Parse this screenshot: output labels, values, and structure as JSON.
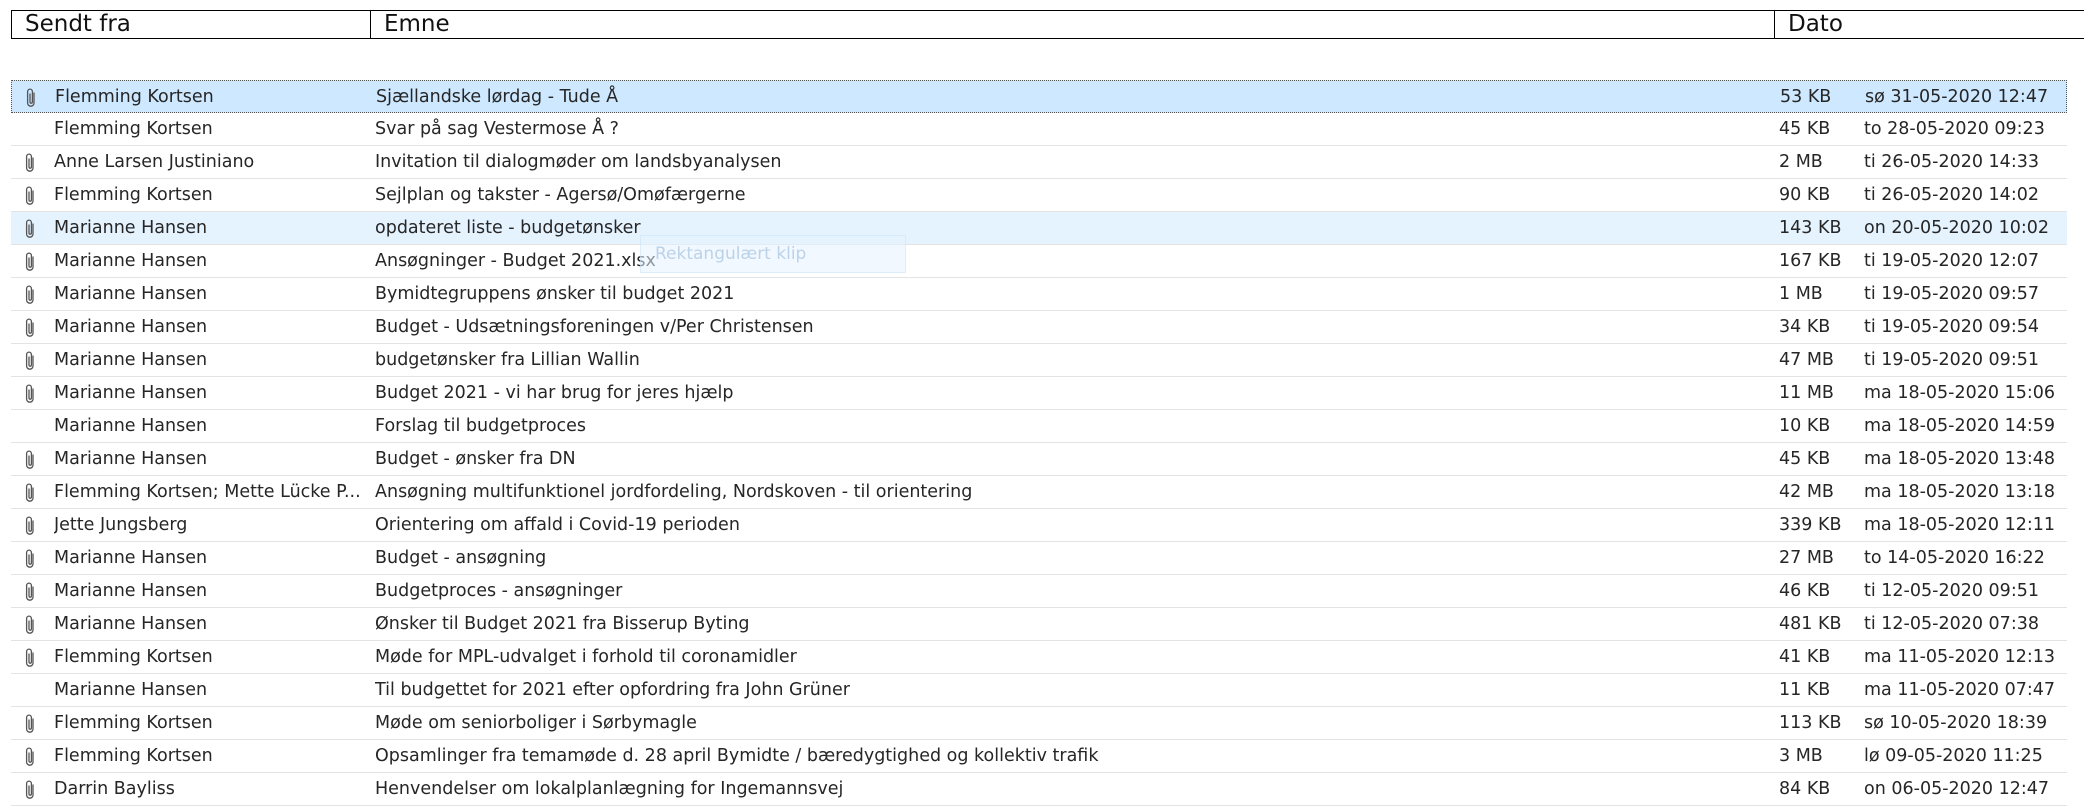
{
  "columns": {
    "from": "Sendt fra",
    "subject": "Emne",
    "date": "Dato"
  },
  "ghost_label": "Rektangulært klip",
  "emails": [
    {
      "from": "Flemming Kortsen",
      "subject": "Sjællandske lørdag - Tude Å",
      "size": "53 KB",
      "date": "sø 31-05-2020 12:47",
      "attachment": true,
      "state": "selected-focus"
    },
    {
      "from": "Flemming Kortsen",
      "subject": "Svar på sag Vestermose Å ?",
      "size": "45 KB",
      "date": "to 28-05-2020 09:23",
      "attachment": false,
      "state": ""
    },
    {
      "from": "Anne Larsen Justiniano",
      "subject": "Invitation til dialogmøder om landsbyanalysen",
      "size": "2 MB",
      "date": "ti 26-05-2020 14:33",
      "attachment": true,
      "state": ""
    },
    {
      "from": "Flemming Kortsen",
      "subject": "Sejlplan og takster - Agersø/Omøfærgerne",
      "size": "90 KB",
      "date": "ti 26-05-2020 14:02",
      "attachment": true,
      "state": ""
    },
    {
      "from": "Marianne Hansen",
      "subject": "opdateret liste - budgetønsker",
      "size": "143 KB",
      "date": "on 20-05-2020 10:02",
      "attachment": true,
      "state": "hover"
    },
    {
      "from": "Marianne Hansen",
      "subject": "Ansøgninger - Budget 2021.xlsx",
      "size": "167 KB",
      "date": "ti 19-05-2020 12:07",
      "attachment": true,
      "state": ""
    },
    {
      "from": "Marianne Hansen",
      "subject": "Bymidtegruppens ønsker til budget 2021",
      "size": "1 MB",
      "date": "ti 19-05-2020 09:57",
      "attachment": true,
      "state": ""
    },
    {
      "from": "Marianne Hansen",
      "subject": "Budget - Udsætningsforeningen v/Per Christensen",
      "size": "34 KB",
      "date": "ti 19-05-2020 09:54",
      "attachment": true,
      "state": ""
    },
    {
      "from": "Marianne Hansen",
      "subject": "budgetønsker fra Lillian Wallin",
      "size": "47 MB",
      "date": "ti 19-05-2020 09:51",
      "attachment": true,
      "state": ""
    },
    {
      "from": "Marianne Hansen",
      "subject": "Budget 2021 - vi har brug for jeres hjælp",
      "size": "11 MB",
      "date": "ma 18-05-2020 15:06",
      "attachment": true,
      "state": ""
    },
    {
      "from": "Marianne Hansen",
      "subject": "Forslag til budgetproces",
      "size": "10 KB",
      "date": "ma 18-05-2020 14:59",
      "attachment": false,
      "state": ""
    },
    {
      "from": "Marianne Hansen",
      "subject": "Budget - ønsker fra DN",
      "size": "45 KB",
      "date": "ma 18-05-2020 13:48",
      "attachment": true,
      "state": ""
    },
    {
      "from": "Flemming Kortsen;  Mette Lücke P...",
      "subject": "Ansøgning multifunktionel jordfordeling, Nordskoven - til orientering",
      "size": "42 MB",
      "date": "ma 18-05-2020 13:18",
      "attachment": true,
      "state": ""
    },
    {
      "from": "Jette Jungsberg",
      "subject": "Orientering om affald i Covid-19 perioden",
      "size": "339 KB",
      "date": "ma 18-05-2020 12:11",
      "attachment": true,
      "state": ""
    },
    {
      "from": "Marianne Hansen",
      "subject": "Budget - ansøgning",
      "size": "27 MB",
      "date": "to 14-05-2020 16:22",
      "attachment": true,
      "state": ""
    },
    {
      "from": "Marianne Hansen",
      "subject": "Budgetproces - ansøgninger",
      "size": "46 KB",
      "date": "ti 12-05-2020 09:51",
      "attachment": true,
      "state": ""
    },
    {
      "from": "Marianne Hansen",
      "subject": "Ønsker til Budget 2021 fra Bisserup Byting",
      "size": "481 KB",
      "date": "ti 12-05-2020 07:38",
      "attachment": true,
      "state": ""
    },
    {
      "from": "Flemming Kortsen",
      "subject": "Møde for MPL-udvalget i forhold til coronamidler",
      "size": "41 KB",
      "date": "ma 11-05-2020 12:13",
      "attachment": true,
      "state": ""
    },
    {
      "from": "Marianne Hansen",
      "subject": "Til budgettet for 2021 efter opfordring fra John Grüner",
      "size": "11 KB",
      "date": "ma 11-05-2020 07:47",
      "attachment": false,
      "state": ""
    },
    {
      "from": "Flemming Kortsen",
      "subject": " Møde om seniorboliger i Sørbymagle",
      "size": "113 KB",
      "date": "sø 10-05-2020 18:39",
      "attachment": true,
      "state": ""
    },
    {
      "from": "Flemming Kortsen",
      "subject": "Opsamlinger fra temamøde d. 28 april Bymidte / bæredygtighed og kollektiv trafik",
      "size": "3 MB",
      "date": "lø 09-05-2020 11:25",
      "attachment": true,
      "state": ""
    },
    {
      "from": "Darrin Bayliss",
      "subject": "Henvendelser om lokalplanlægning for Ingemannsvej",
      "size": "84 KB",
      "date": "on 06-05-2020 12:47",
      "attachment": true,
      "state": ""
    }
  ]
}
